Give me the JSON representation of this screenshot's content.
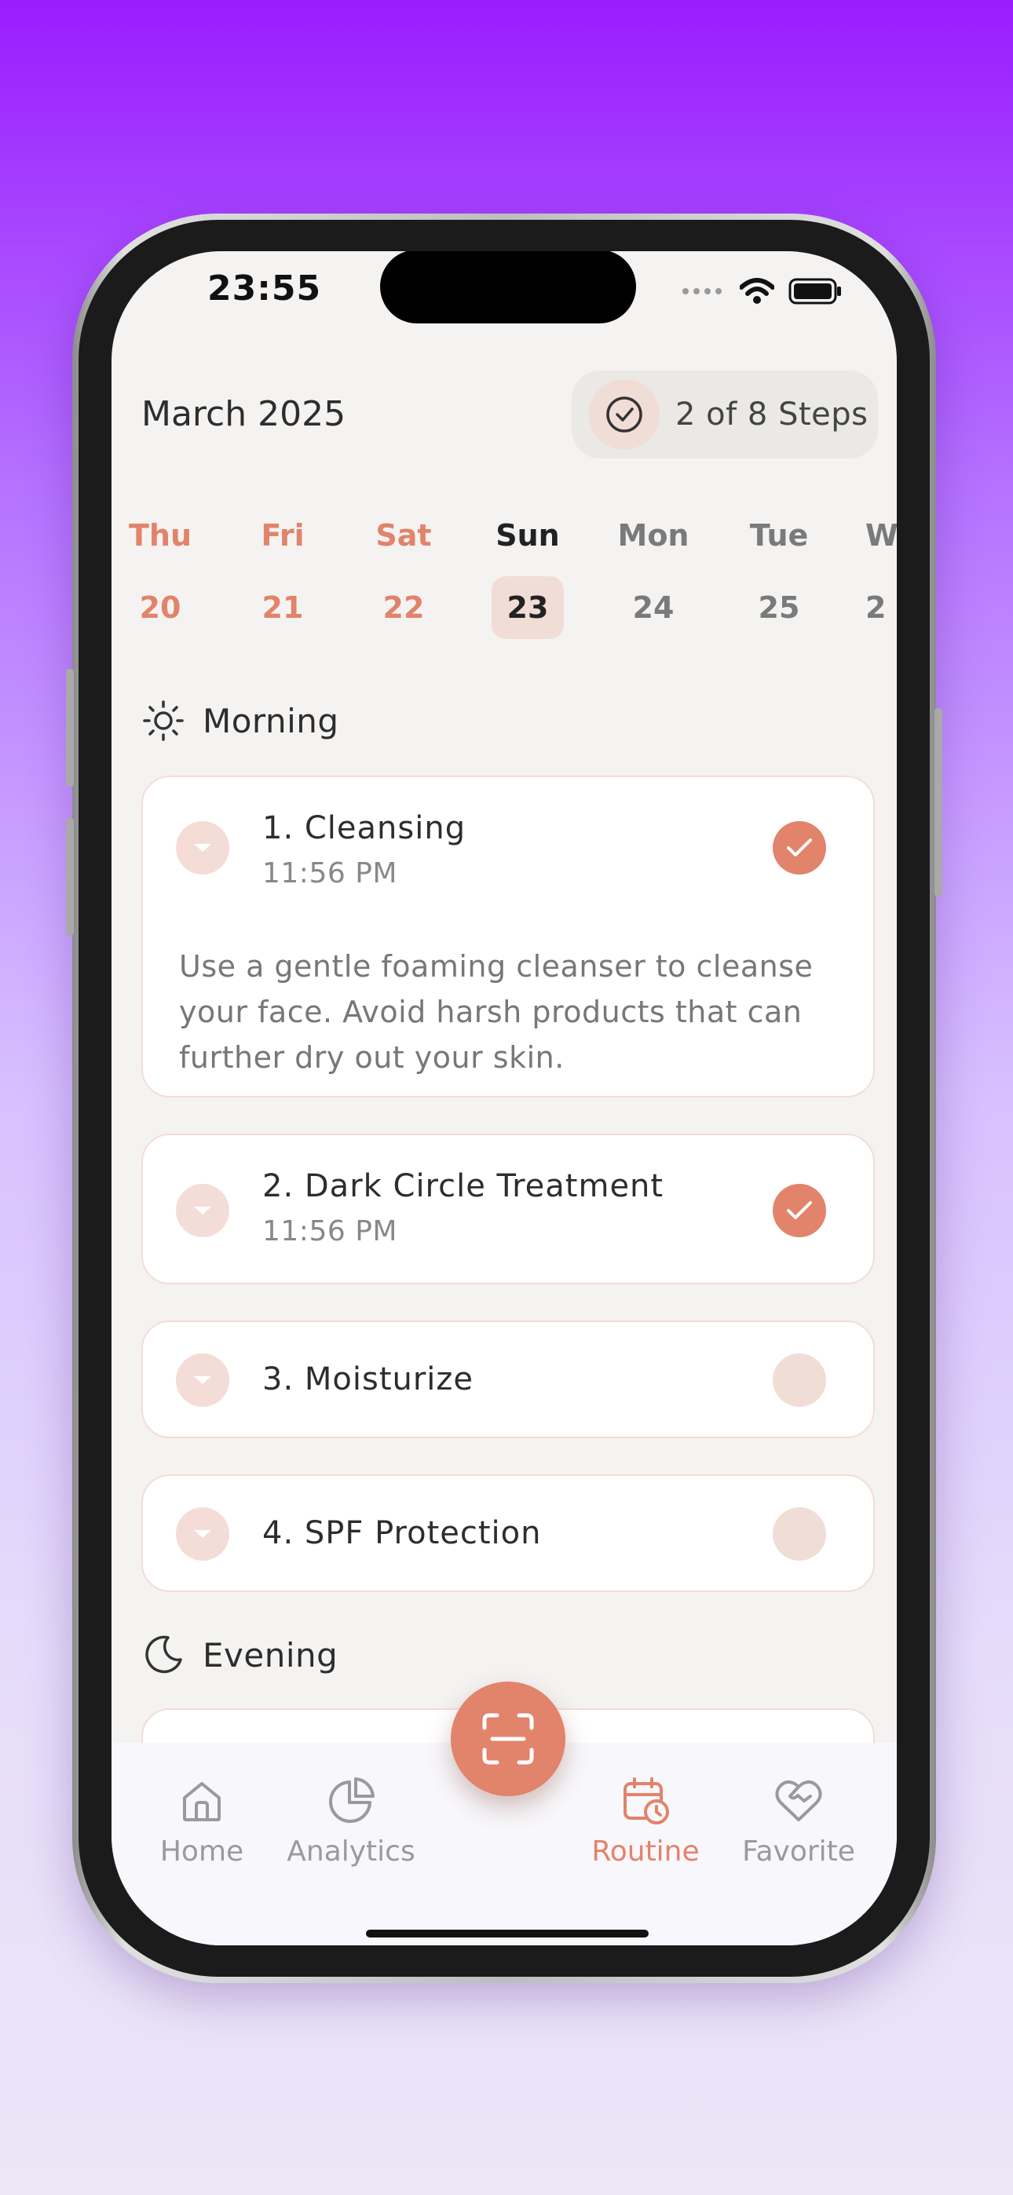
{
  "status_bar": {
    "time": "23:55"
  },
  "header": {
    "month": "March 2025",
    "steps": "2 of 8 Steps"
  },
  "days": [
    {
      "name": "Thu",
      "date": "20",
      "state": "past"
    },
    {
      "name": "Fri",
      "date": "21",
      "state": "past"
    },
    {
      "name": "Sat",
      "date": "22",
      "state": "past"
    },
    {
      "name": "Sun",
      "date": "23",
      "state": "selected"
    },
    {
      "name": "Mon",
      "date": "24",
      "state": "future"
    },
    {
      "name": "Tue",
      "date": "25",
      "state": "future"
    },
    {
      "name": "W",
      "date": "2",
      "state": "future"
    }
  ],
  "morning": {
    "label": "Morning",
    "items": [
      {
        "title": "1. Cleansing",
        "time": "11:56 PM",
        "done": true,
        "description": "Use a gentle foaming cleanser to cleanse your face. Avoid harsh products that can further dry out your skin."
      },
      {
        "title": "2. Dark Circle Treatment",
        "time": "11:56 PM",
        "done": true
      },
      {
        "title": "3. Moisturize",
        "done": false
      },
      {
        "title": "4. SPF Protection",
        "done": false
      }
    ]
  },
  "evening": {
    "label": "Evening"
  },
  "tabbar": {
    "home": "Home",
    "analytics": "Analytics",
    "routine": "Routine",
    "favorite": "Favorite",
    "active": "Routine"
  },
  "colors": {
    "accent": "#e2836b",
    "accent_light": "#f3ddd6",
    "background": "#f4f3f2"
  }
}
